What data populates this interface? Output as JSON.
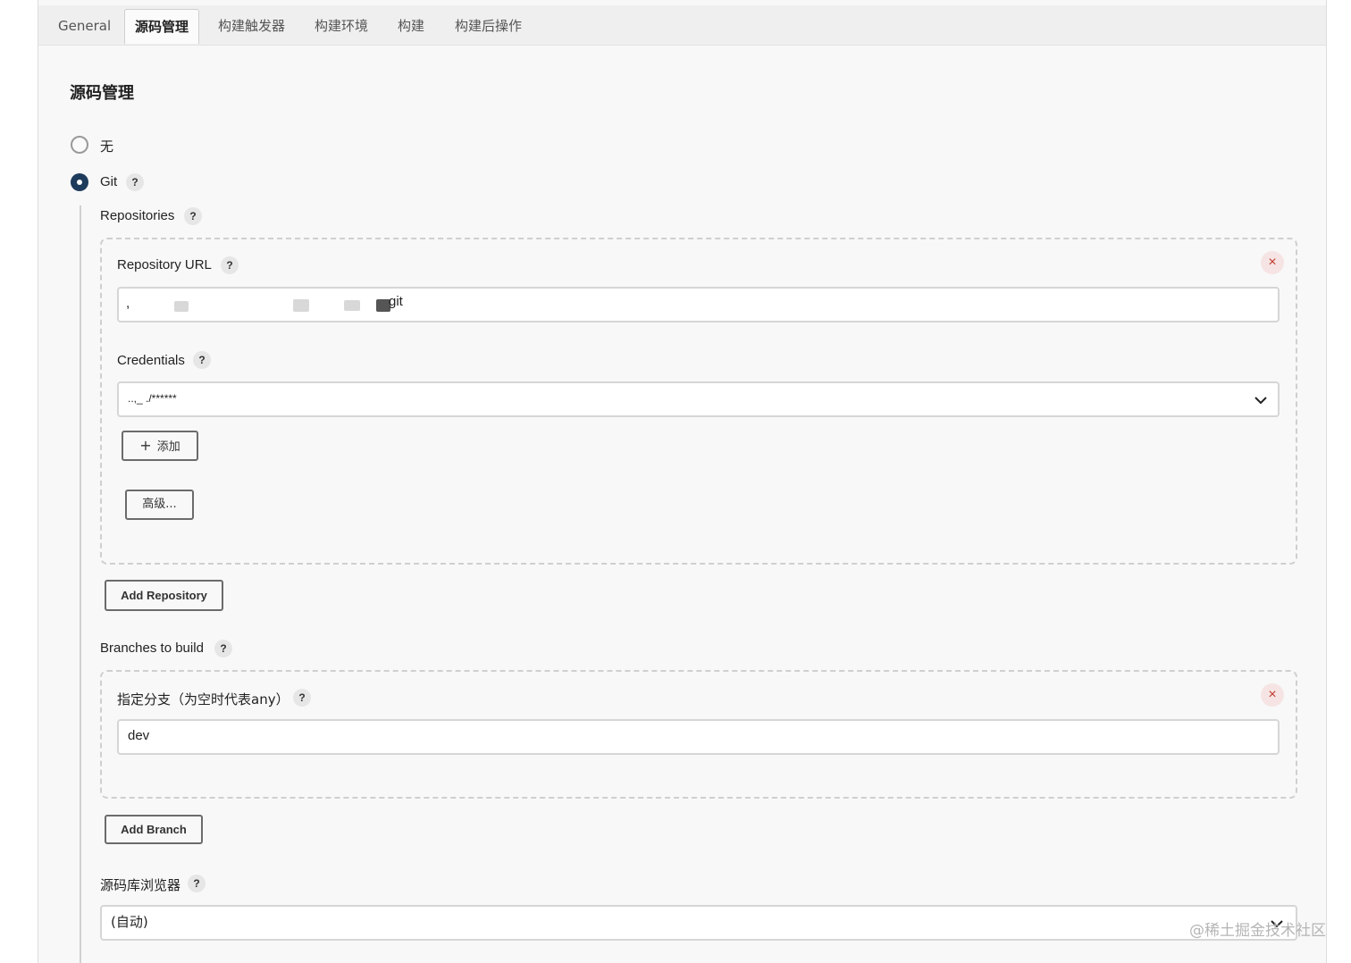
{
  "tabs": [
    {
      "label": "General"
    },
    {
      "label": "源码管理"
    },
    {
      "label": "构建触发器"
    },
    {
      "label": "构建环境"
    },
    {
      "label": "构建"
    },
    {
      "label": "构建后操作"
    }
  ],
  "active_tab": "源码管理",
  "section_title": "源码管理",
  "scm_options": {
    "none_label": "无",
    "git_label": "Git",
    "selected": "Git"
  },
  "help_glyph": "?",
  "repositories": {
    "label": "Repositories",
    "url_label": "Repository URL",
    "url_value": "git",
    "url_leading_char": ",",
    "credentials_label": "Credentials",
    "credentials_value": "..,_ ./******",
    "add_credentials_label": "添加",
    "add_icon": "+",
    "advanced_label": "高级...",
    "remove_icon": "×",
    "add_repository_label": "Add Repository"
  },
  "branches": {
    "label": "Branches to build",
    "specifier_label": "指定分支（为空时代表any）",
    "specifier_value": "dev",
    "remove_icon": "×",
    "add_branch_label": "Add Branch"
  },
  "browser": {
    "label": "源码库浏览器",
    "value": "(自动)"
  },
  "watermark": "@稀土掘金技术社区",
  "colors": {
    "radio_selected": "#1e3b5c",
    "remove_icon": "#c0392b"
  }
}
